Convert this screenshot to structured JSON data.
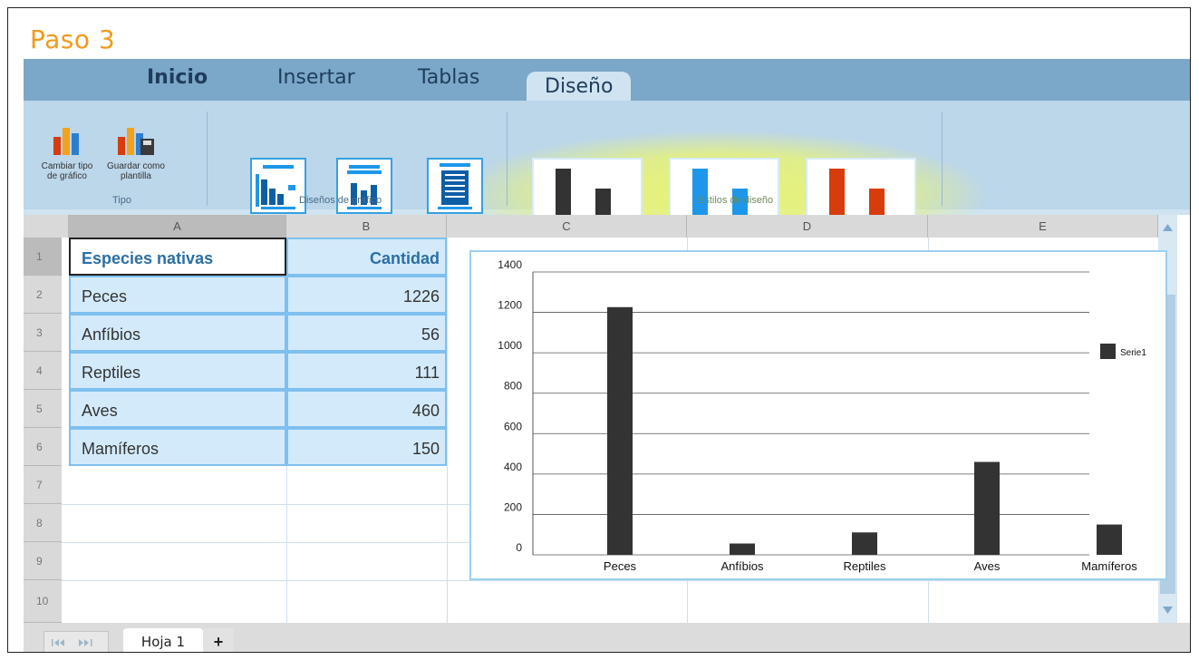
{
  "step_title": "Paso 3",
  "tabs": [
    {
      "label": "Inicio",
      "active": false
    },
    {
      "label": "Insertar",
      "active": false
    },
    {
      "label": "Tablas",
      "active": false
    },
    {
      "label": "Diseño",
      "active": true
    }
  ],
  "ribbon": {
    "tipo": {
      "label": "Tipo",
      "buttons": [
        {
          "label": "Cambiar tipo de gráfico",
          "icon": "bar-chart-icon"
        },
        {
          "label": "Guardar como plantilla",
          "icon": "save-template-icon"
        }
      ]
    },
    "disenos": {
      "label": "Diseños de gráfico",
      "layouts": [
        "layout-1",
        "layout-2",
        "layout-3"
      ]
    },
    "estilos": {
      "label": "Estilos de diseño",
      "styles": [
        {
          "name": "style-dark",
          "color": "#333333"
        },
        {
          "name": "style-blue",
          "color": "#1e97ea"
        },
        {
          "name": "style-red",
          "color": "#d63c0c"
        }
      ]
    }
  },
  "columns": [
    "A",
    "B",
    "C",
    "D",
    "E"
  ],
  "rows": [
    "1",
    "2",
    "3",
    "4",
    "5",
    "6",
    "7",
    "8",
    "9",
    "10"
  ],
  "table": {
    "header": {
      "species": "Especies nativas",
      "count": "Cantidad"
    },
    "rows": [
      {
        "species": "Peces",
        "count": "1226"
      },
      {
        "species": "Anfíbios",
        "count": "56"
      },
      {
        "species": "Reptiles",
        "count": "111"
      },
      {
        "species": "Aves",
        "count": "460"
      },
      {
        "species": "Mamíferos",
        "count": "150"
      }
    ]
  },
  "sheet": {
    "tab_label": "Hoja 1",
    "add_label": "+"
  },
  "colors": {
    "accent": "#f29a1b",
    "tab_bar": "#7ba7c8",
    "ribbon": "#bcd6ea",
    "header_text": "#2a6fa5",
    "selection": "#d3eafb"
  },
  "chart_data": {
    "type": "bar",
    "categories": [
      "Peces",
      "Anfíbios",
      "Reptiles",
      "Aves",
      "Mamíferos"
    ],
    "series": [
      {
        "name": "Serie1",
        "values": [
          1226,
          56,
          111,
          460,
          150
        ],
        "color": "#333333"
      }
    ],
    "yticks": [
      "0",
      "200",
      "400",
      "600",
      "800",
      "1000",
      "1200",
      "1400"
    ],
    "ylim": [
      0,
      1400
    ],
    "grid": true,
    "legend": "right"
  }
}
